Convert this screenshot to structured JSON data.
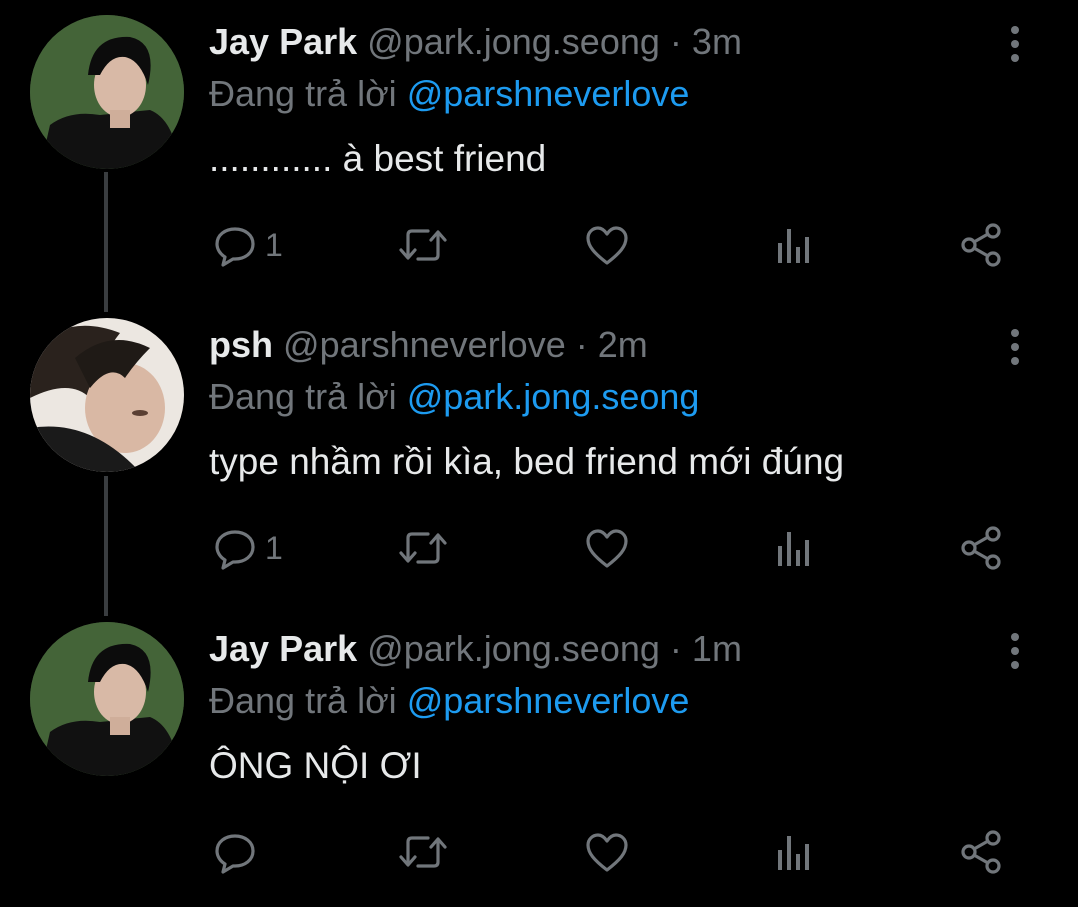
{
  "tweets": [
    {
      "name": "Jay Park",
      "handle": "@park.jong.seong",
      "dot": "·",
      "time": "3m",
      "reply_prefix": "Đang trả lời",
      "reply_to": "@parshneverlove",
      "text": "............ à best friend",
      "reply_count": "1",
      "avatar": "avatar-jay-park"
    },
    {
      "name": "psh",
      "handle": "@parshneverlove",
      "dot": "·",
      "time": "2m",
      "reply_prefix": "Đang trả lời",
      "reply_to": "@park.jong.seong",
      "text": "type nhầm rồi kìa, bed friend mới đúng",
      "reply_count": "1",
      "avatar": "avatar-psh"
    },
    {
      "name": "Jay Park",
      "handle": "@park.jong.seong",
      "dot": "·",
      "time": "1m",
      "reply_prefix": "Đang trả lời",
      "reply_to": "@parshneverlove",
      "text": "ÔNG NỘI ƠI",
      "reply_count": "",
      "avatar": "avatar-jay-park"
    }
  ],
  "icons": {
    "reply": "reply-icon",
    "retweet": "retweet-icon",
    "like": "heart-icon",
    "views": "analytics-icon",
    "share": "share-icon",
    "more": "more-options-icon"
  },
  "colors": {
    "background": "#000000",
    "primary_text": "#e7e9ea",
    "secondary_text": "#71767b",
    "accent": "#1d9bf0",
    "thread_line": "#3a3d40"
  }
}
